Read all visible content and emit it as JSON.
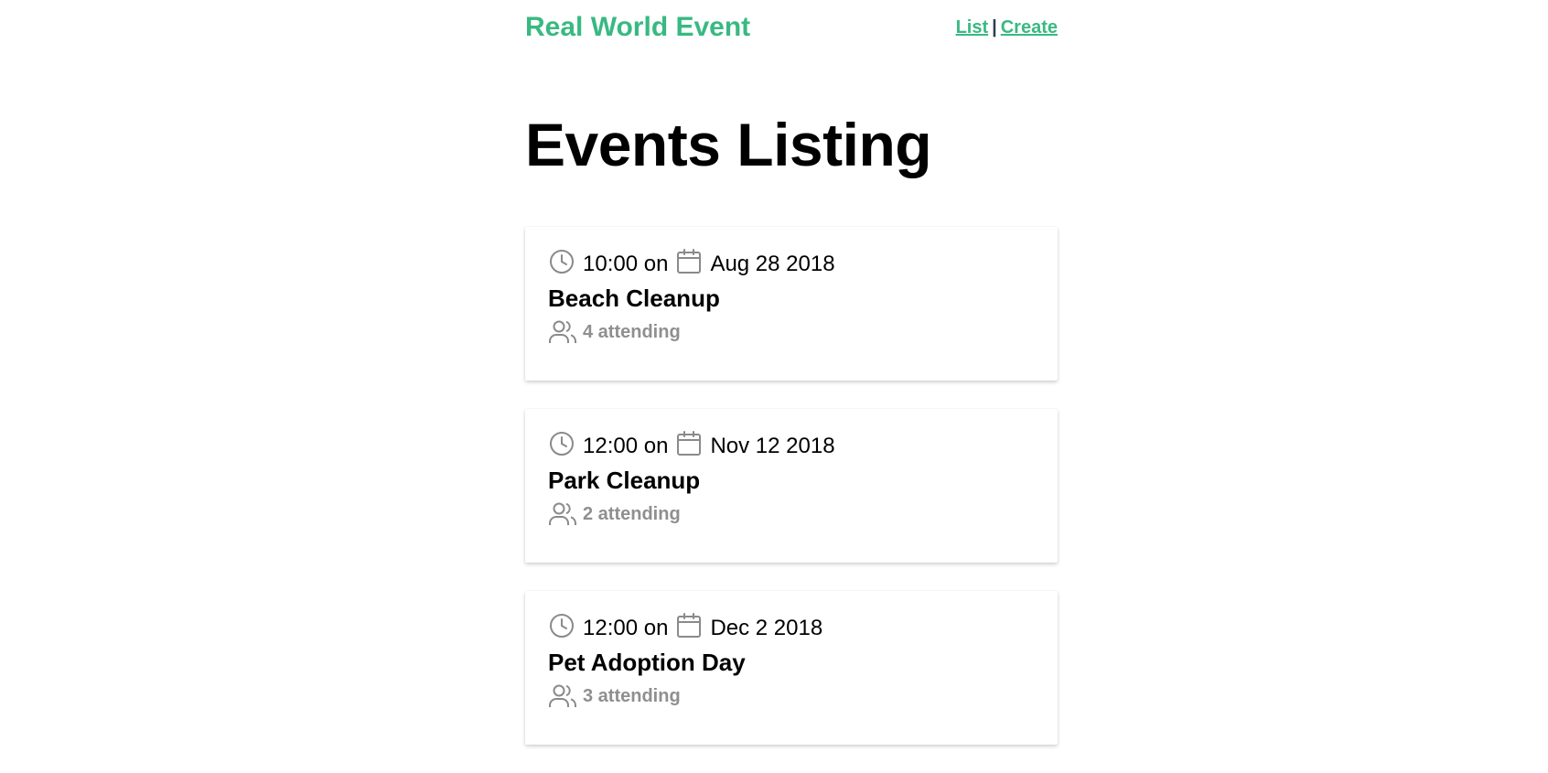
{
  "header": {
    "brand": "Real World Event",
    "nav_links": [
      {
        "label": "List"
      },
      {
        "label": "Create"
      }
    ],
    "separator": "|"
  },
  "page": {
    "title": "Events Listing"
  },
  "events": [
    {
      "time": "10:00",
      "on_text": "on",
      "date": "Aug 28 2018",
      "title": "Beach Cleanup",
      "attending": "4 attending"
    },
    {
      "time": "12:00",
      "on_text": "on",
      "date": "Nov 12 2018",
      "title": "Park Cleanup",
      "attending": "2 attending"
    },
    {
      "time": "12:00",
      "on_text": "on",
      "date": "Dec 2 2018",
      "title": "Pet Adoption Day",
      "attending": "3 attending"
    }
  ],
  "icons": {
    "time": "clock-icon",
    "date": "calendar-icon",
    "attendees": "users-icon"
  },
  "colors": {
    "brand": "#39b982",
    "muted": "#8f8f8f",
    "icon": "#8a8a8a"
  }
}
